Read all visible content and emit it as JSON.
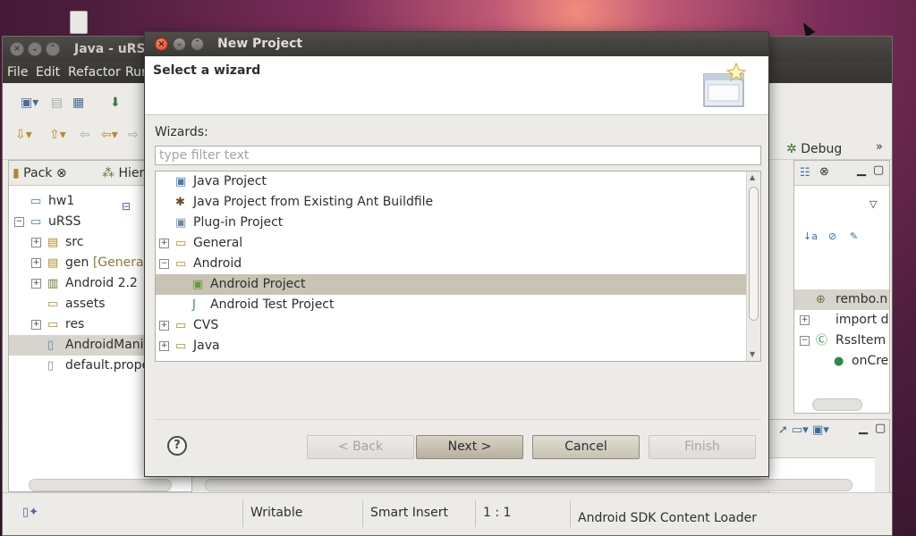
{
  "eclipse": {
    "title": "Java - uRSS",
    "menu": [
      "File",
      "Edit",
      "Refactor",
      "Run"
    ],
    "perspective_debug": "Debug",
    "package_explorer": {
      "tabs": [
        "Pack",
        "Hiera"
      ],
      "tree": [
        {
          "label": "hw1",
          "icon": "project-icon",
          "level": 0,
          "expand": ""
        },
        {
          "label": "uRSS",
          "icon": "project-icon",
          "level": 0,
          "expand": "−"
        },
        {
          "label": "src",
          "icon": "source-folder-icon",
          "level": 1,
          "expand": "+"
        },
        {
          "label": "gen",
          "decoration": "[Generate",
          "icon": "source-folder-icon",
          "level": 1,
          "expand": "+"
        },
        {
          "label": "Android 2.2",
          "icon": "library-icon",
          "level": 1,
          "expand": "+"
        },
        {
          "label": "assets",
          "icon": "folder-icon",
          "level": 1,
          "expand": ""
        },
        {
          "label": "res",
          "icon": "folder-icon",
          "level": 1,
          "expand": "+"
        },
        {
          "label": "AndroidManife",
          "icon": "xml-file-icon",
          "level": 1,
          "expand": "",
          "selected": true
        },
        {
          "label": "default.proper",
          "icon": "file-icon",
          "level": 1,
          "expand": ""
        }
      ]
    },
    "outline": {
      "items": [
        {
          "label": "rembo.n",
          "selected": true
        },
        {
          "label": "import d",
          "expand": "+"
        },
        {
          "label": "RssItem",
          "expand": "−"
        },
        {
          "label": "onCre"
        }
      ]
    },
    "status": {
      "writable": "Writable",
      "insert_mode": "Smart Insert",
      "position": "1 : 1",
      "loader": "Android SDK Content Loader"
    }
  },
  "dialog": {
    "title": "New Project",
    "header_title": "Select a wizard",
    "wizards_label": "Wizards:",
    "filter_placeholder": "type filter text",
    "filter_value": "",
    "items": [
      {
        "label": "Java Project",
        "icon": "java-project-icon",
        "level": 0,
        "expand": ""
      },
      {
        "label": "Java Project from Existing Ant Buildfile",
        "icon": "ant-icon",
        "level": 0,
        "expand": ""
      },
      {
        "label": "Plug-in Project",
        "icon": "plugin-project-icon",
        "level": 0,
        "expand": ""
      },
      {
        "label": "General",
        "icon": "folder-icon",
        "level": 0,
        "expand": "+"
      },
      {
        "label": "Android",
        "icon": "folder-icon",
        "level": 0,
        "expand": "−"
      },
      {
        "label": "Android Project",
        "icon": "android-project-icon",
        "level": 1,
        "expand": "",
        "selected": true
      },
      {
        "label": "Android Test Project",
        "icon": "android-test-icon",
        "level": 1,
        "expand": ""
      },
      {
        "label": "CVS",
        "icon": "folder-icon",
        "level": 0,
        "expand": "+"
      },
      {
        "label": "Java",
        "icon": "folder-icon",
        "level": 0,
        "expand": "+"
      }
    ],
    "buttons": {
      "back": "< Back",
      "next": "Next >",
      "cancel": "Cancel",
      "finish": "Finish"
    },
    "help_glyph": "?"
  }
}
